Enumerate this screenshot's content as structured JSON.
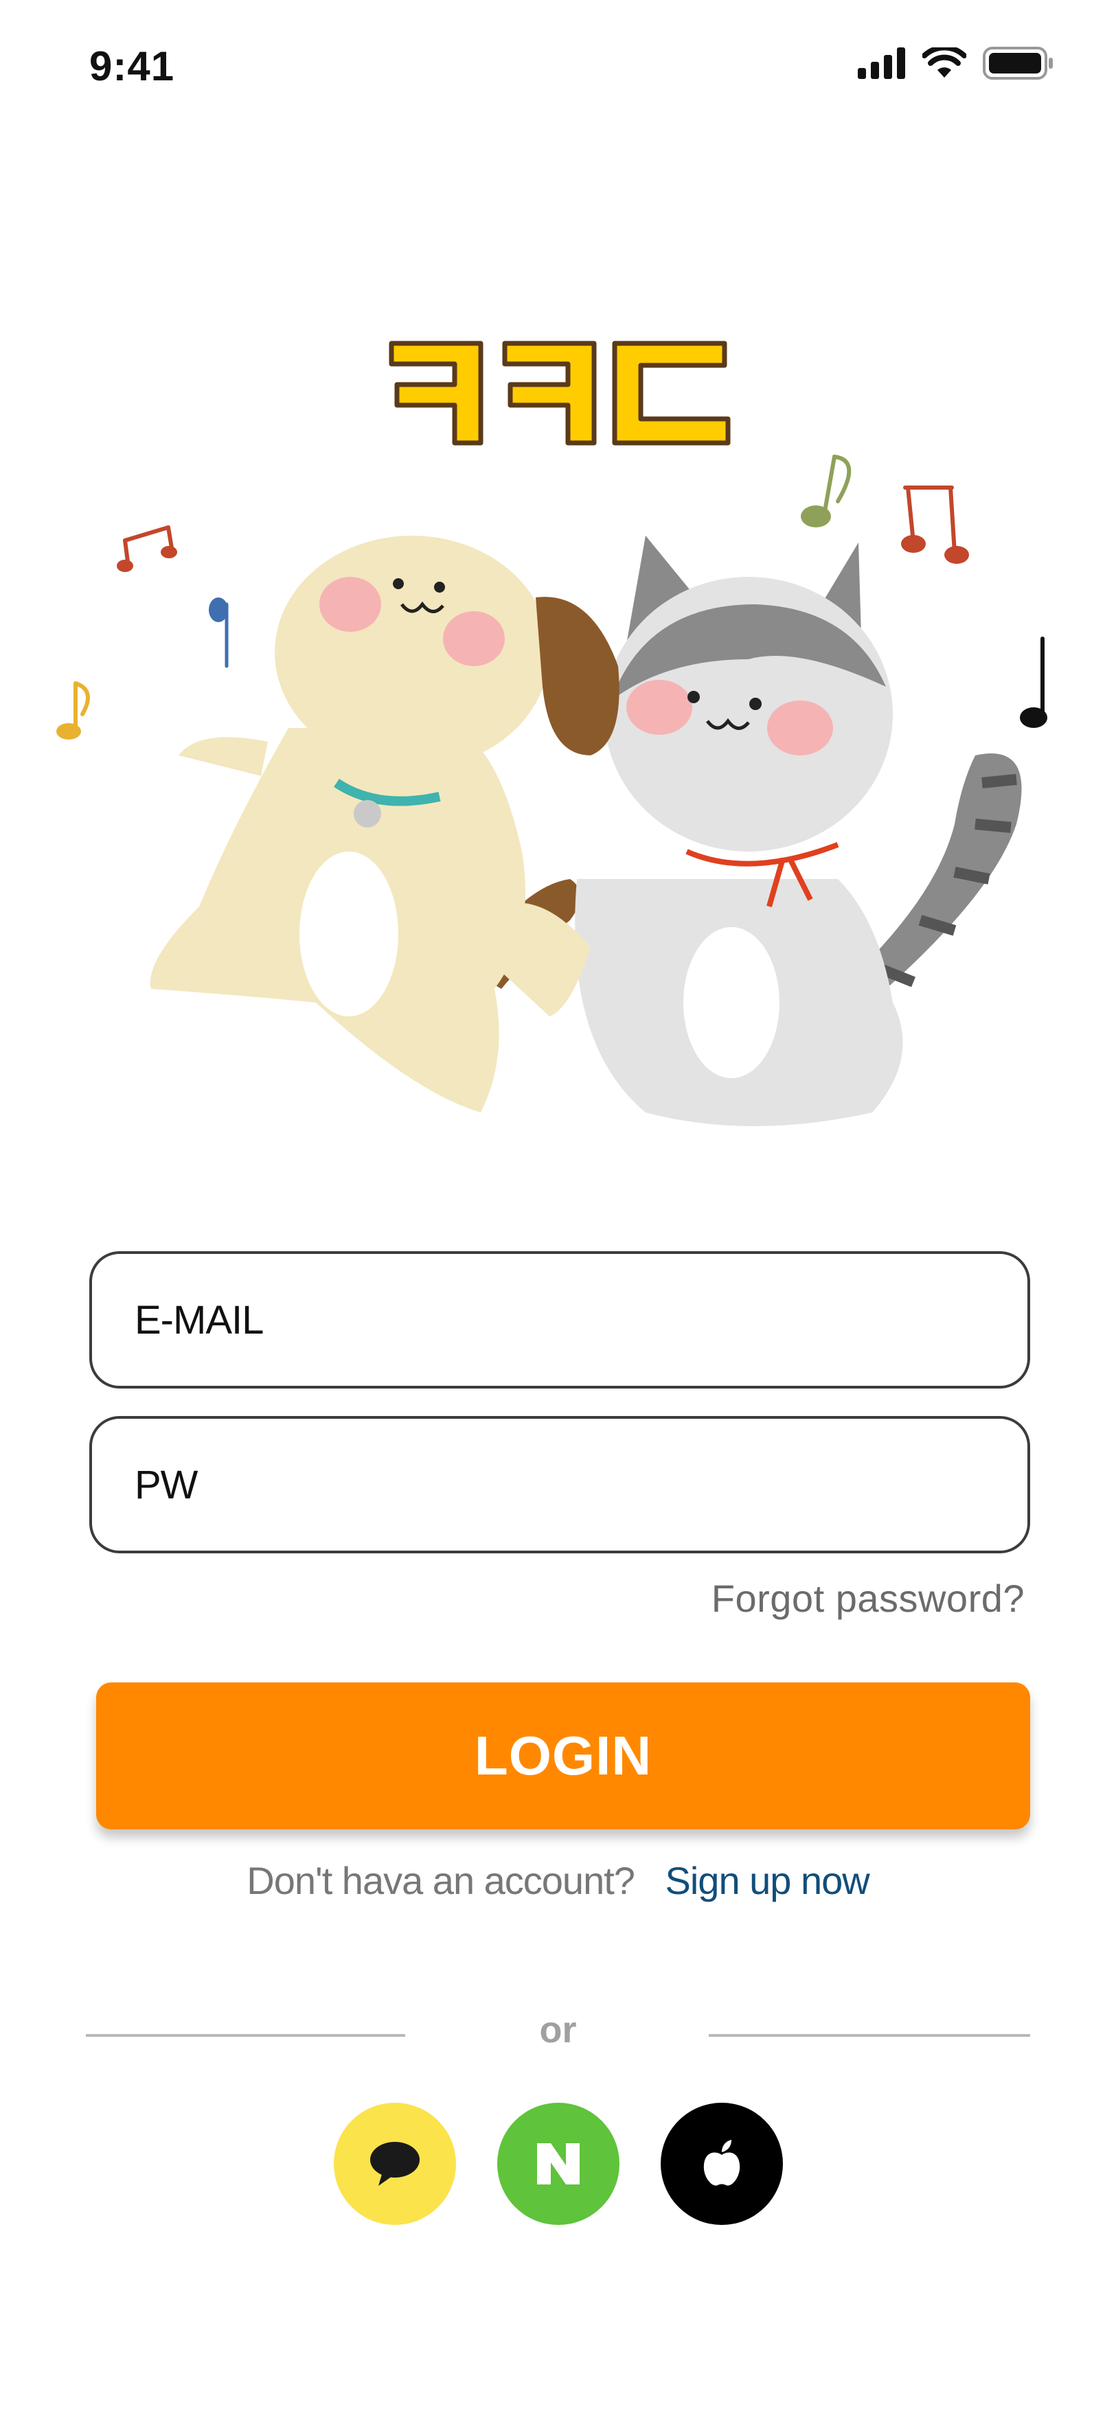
{
  "status_bar": {
    "time": "9:41",
    "icons": [
      "signal-icon",
      "wifi-icon",
      "battery-icon"
    ]
  },
  "logo": {
    "text": "ㅋㅋㄷ",
    "fill_color": "#ffcc00",
    "outline_color": "#5a3a1a"
  },
  "illustration": {
    "subjects": [
      "dog",
      "cat",
      "music-notes"
    ]
  },
  "form": {
    "email_placeholder": "E-MAIL",
    "password_placeholder": "PW",
    "forgot_password": "Forgot password?",
    "login_label": "LOGIN",
    "login_color": "#ff8800"
  },
  "signup": {
    "question": "Don't hava an account?",
    "link": "Sign up now"
  },
  "divider": {
    "label": "or"
  },
  "social": [
    {
      "name": "kakao",
      "icon": "speech-bubble-icon",
      "color": "#fbe34c"
    },
    {
      "name": "naver",
      "icon": "naver-n-icon",
      "color": "#5fc33b"
    },
    {
      "name": "apple",
      "icon": "apple-icon",
      "color": "#000000"
    }
  ]
}
